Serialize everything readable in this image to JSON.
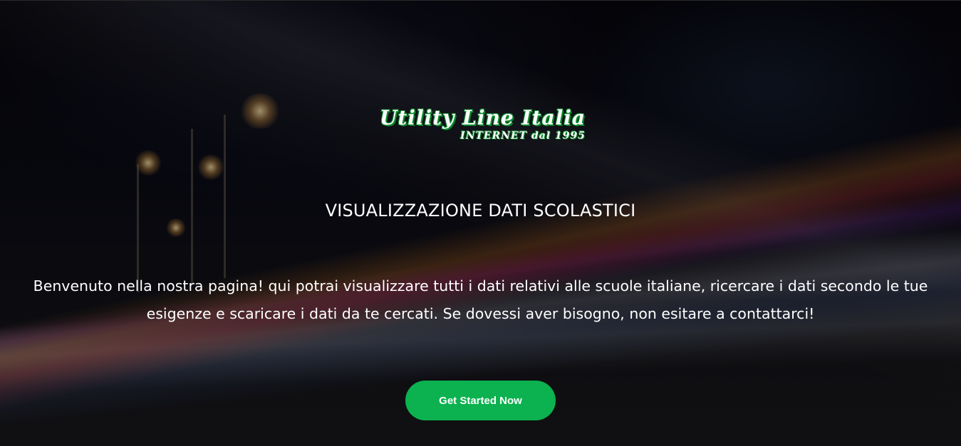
{
  "logo": {
    "title": "Utility Line Italia",
    "subtitle": "INTERNET dal 1995",
    "accent_color": "#0c8a2c"
  },
  "hero": {
    "title": "VISUALIZZAZIONE DATI SCOLASTICI",
    "intro": "Benvenuto nella nostra pagina! qui potrai visualizzare tutti i dati relativi alle scuole italiane, ricercare i dati secondo le tue esigenze e scaricare i dati da te cercati. Se dovessi aver bisogno, non esitare a contattarci!",
    "cta_label": "Get Started Now",
    "cta_color": "#0bb24f"
  }
}
